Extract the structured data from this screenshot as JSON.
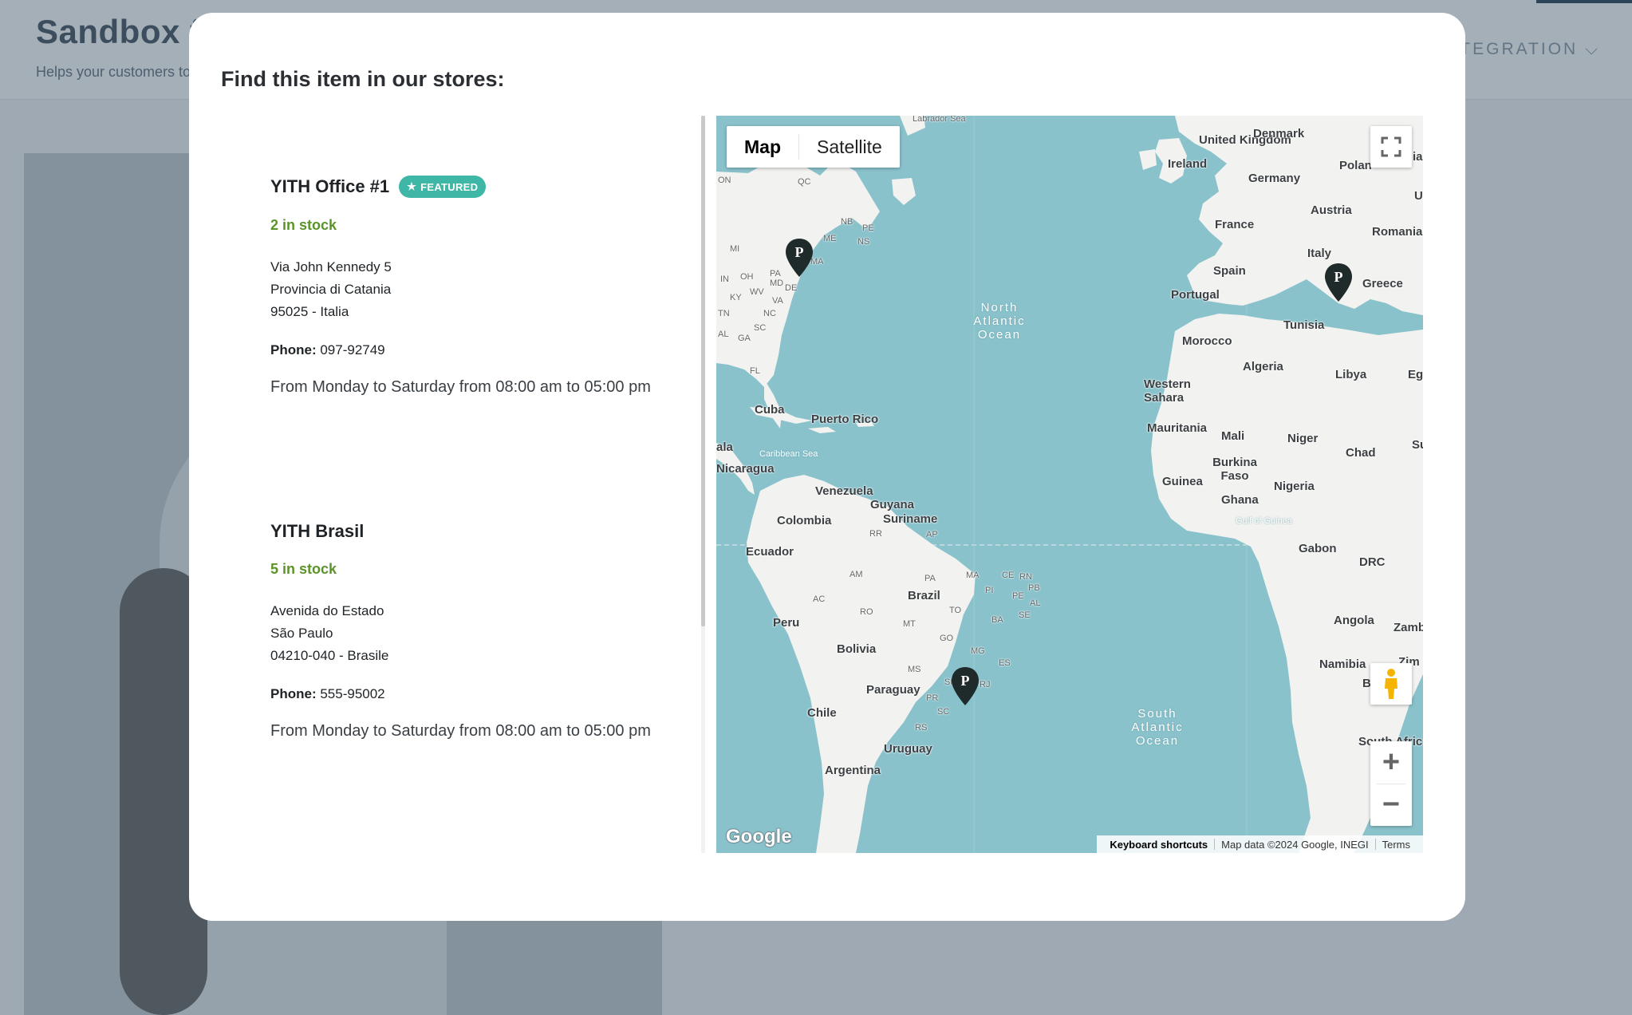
{
  "background": {
    "site_title": "Sandbox fo",
    "tagline": "Helps your customers to",
    "menu_item": "NTEGRATION"
  },
  "modal": {
    "title": "Find this item in our stores:"
  },
  "stores": [
    {
      "name": "YITH Office #1",
      "badge": "FEATURED",
      "stock": "2 in stock",
      "address_line1": "Via John Kennedy 5",
      "address_line2": "Provincia di Catania",
      "address_line3": "95025 - Italia",
      "phone_label": "Phone:",
      "phone": "097-92749",
      "hours": "From Monday to Saturday from 08:00 am to 05:00 pm"
    },
    {
      "name": "YITH Brasil",
      "stock": "5 in stock",
      "address_line1": "Avenida do Estado",
      "address_line2": "São Paulo",
      "address_line3": "04210-040 - Brasile",
      "phone_label": "Phone:",
      "phone": "555-95002",
      "hours": "From Monday to Saturday from 08:00 am to 05:00 pm"
    }
  ],
  "map": {
    "type_map": "Map",
    "type_satellite": "Satellite",
    "logo": "Google",
    "keyboard_shortcuts": "Keyboard shortcuts",
    "map_data": "Map data ©2024 Google, INEGI",
    "terms": "Terms",
    "pin_letter": "P",
    "labels": {
      "labrador_sea": "Labrador Sea",
      "uk": "United Kingdom",
      "denmark": "Denmark",
      "ireland": "Ireland",
      "poland": "Polan",
      "germany": "Germany",
      "france": "France",
      "austria": "Austria",
      "romania": "Romania",
      "italy": "Italy",
      "spain": "Spain",
      "portugal": "Portugal",
      "greece": "Greece",
      "tunisia": "Tunisia",
      "morocco": "Morocco",
      "algeria": "Algeria",
      "libya": "Libya",
      "eg": "Eg",
      "western_sahara": "Western Sahara",
      "mauritania": "Mauritania",
      "mali": "Mali",
      "niger": "Niger",
      "chad": "Chad",
      "su": "Su",
      "burkina": "Burkina Faso",
      "guinea": "Guinea",
      "nigeria": "Nigeria",
      "ghana": "Ghana",
      "gulf_guinea": "Gulf of Guinea",
      "gabon": "Gabon",
      "drc": "DRC",
      "angola": "Angola",
      "zamb": "Zamb",
      "namibia": "Namibia",
      "zim": "Zim",
      "b": "B",
      "south_africa": "South Afric",
      "na_ocean": "North Atlantic Ocean",
      "sa_ocean": "South Atlantic Ocean",
      "qc": "QC",
      "on": "ON",
      "nb": "NB",
      "pe": "PE",
      "me": "ME",
      "ns": "NS",
      "mi": "MI",
      "ma": "MA",
      "oh": "OH",
      "pa": "PA",
      "in": "IN",
      "md": "MD",
      "de": "DE",
      "wv": "WV",
      "va": "VA",
      "ky": "KY",
      "tn": "TN",
      "nc": "NC",
      "sc": "SC",
      "al": "AL",
      "ga": "GA",
      "fl": "FL",
      "cuba": "Cuba",
      "puerto_rico": "Puerto Rico",
      "ala": "ala",
      "caribbean": "Caribbean Sea",
      "nicaragua": "Nicaragua",
      "venezuela": "Venezuela",
      "guyana": "Guyana",
      "suriname": "Suriname",
      "colombia": "Colombia",
      "rr": "RR",
      "ap": "AP",
      "ecuador": "Ecuador",
      "am": "AM",
      "pa_br": "PA",
      "ma_br": "MA",
      "ce": "CE",
      "rn": "RN",
      "pb": "PB",
      "pi": "PI",
      "pe_br": "PE",
      "al_br": "AL",
      "se": "SE",
      "peru": "Peru",
      "ac": "AC",
      "ro": "RO",
      "brazil": "Brazil",
      "to": "TO",
      "ba": "BA",
      "mt": "MT",
      "go": "GO",
      "bolivia": "Bolivia",
      "mg": "MG",
      "es": "ES",
      "ms": "MS",
      "sp": "SP",
      "rj": "RJ",
      "paraguay": "Paraguay",
      "pr": "PR",
      "chile": "Chile",
      "sc_br": "SC",
      "rs": "RS",
      "uruguay": "Uruguay",
      "argentina": "Argentina",
      "u": "U",
      "ia": "ia"
    }
  },
  "colors": {
    "accent_badge": "#3fb7a7",
    "stock_green": "#5a9429",
    "water": "#8ac2cc",
    "land": "#f2f2f0",
    "pin": "#1f2a2a"
  }
}
